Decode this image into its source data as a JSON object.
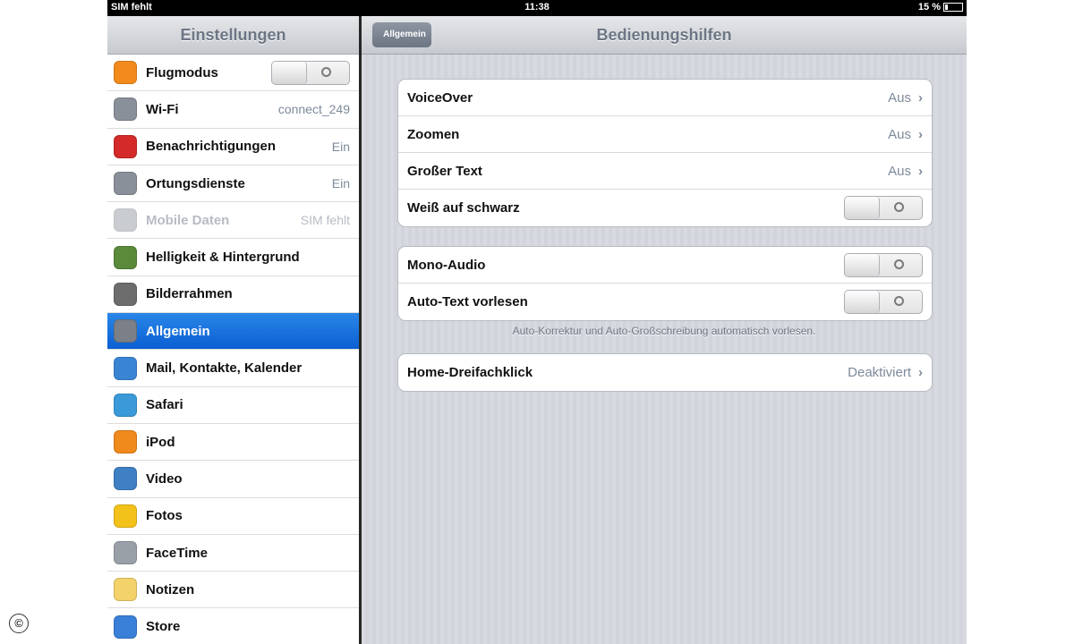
{
  "status": {
    "carrier": "SIM fehlt",
    "time": "11:38",
    "battery": "15 %"
  },
  "sidebar": {
    "title": "Einstellungen",
    "items": [
      {
        "label": "Flugmodus",
        "value": "",
        "icon": "airplane-icon",
        "color": "#f28b1c",
        "toggle": true,
        "disabled": false,
        "selected": false
      },
      {
        "label": "Wi-Fi",
        "value": "connect_249",
        "icon": "wifi-icon",
        "color": "#8a9099",
        "toggle": false,
        "disabled": false,
        "selected": false
      },
      {
        "label": "Benachrichtigungen",
        "value": "Ein",
        "icon": "notifications-icon",
        "color": "#d42a2a",
        "toggle": false,
        "disabled": false,
        "selected": false
      },
      {
        "label": "Ortungsdienste",
        "value": "Ein",
        "icon": "location-icon",
        "color": "#8a9099",
        "toggle": false,
        "disabled": false,
        "selected": false
      },
      {
        "label": "Mobile Daten",
        "value": "SIM fehlt",
        "icon": "cellular-icon",
        "color": "#8a9099",
        "toggle": false,
        "disabled": true,
        "selected": false
      },
      {
        "label": "Helligkeit & Hintergrund",
        "value": "",
        "icon": "brightness-icon",
        "color": "#5a8a3a",
        "toggle": false,
        "disabled": false,
        "selected": false
      },
      {
        "label": "Bilderrahmen",
        "value": "",
        "icon": "picture-frame-icon",
        "color": "#6d6d6d",
        "toggle": false,
        "disabled": false,
        "selected": false
      },
      {
        "label": "Allgemein",
        "value": "",
        "icon": "gear-icon",
        "color": "#7a7f88",
        "toggle": false,
        "disabled": false,
        "selected": true
      },
      {
        "label": "Mail, Kontakte, Kalender",
        "value": "",
        "icon": "mail-icon",
        "color": "#3a84d4",
        "toggle": false,
        "disabled": false,
        "selected": false
      },
      {
        "label": "Safari",
        "value": "",
        "icon": "safari-icon",
        "color": "#3a9ad9",
        "toggle": false,
        "disabled": false,
        "selected": false
      },
      {
        "label": "iPod",
        "value": "",
        "icon": "ipod-icon",
        "color": "#f08a1c",
        "toggle": false,
        "disabled": false,
        "selected": false
      },
      {
        "label": "Video",
        "value": "",
        "icon": "video-icon",
        "color": "#3f7fc4",
        "toggle": false,
        "disabled": false,
        "selected": false
      },
      {
        "label": "Fotos",
        "value": "",
        "icon": "photos-icon",
        "color": "#f3c21a",
        "toggle": false,
        "disabled": false,
        "selected": false
      },
      {
        "label": "FaceTime",
        "value": "",
        "icon": "facetime-icon",
        "color": "#9aa0a8",
        "toggle": false,
        "disabled": false,
        "selected": false
      },
      {
        "label": "Notizen",
        "value": "",
        "icon": "notes-icon",
        "color": "#f3d26a",
        "toggle": false,
        "disabled": false,
        "selected": false
      },
      {
        "label": "Store",
        "value": "",
        "icon": "store-icon",
        "color": "#3a7fd8",
        "toggle": false,
        "disabled": false,
        "selected": false
      }
    ]
  },
  "nav": {
    "back_label": "Allgemein",
    "title": "Bedienungshilfen"
  },
  "group1": {
    "rows": [
      {
        "label": "VoiceOver",
        "value": "Aus",
        "type": "disclosure"
      },
      {
        "label": "Zoomen",
        "value": "Aus",
        "type": "disclosure"
      },
      {
        "label": "Großer Text",
        "value": "Aus",
        "type": "disclosure"
      },
      {
        "label": "Weiß auf schwarz",
        "value": "",
        "type": "toggle"
      }
    ]
  },
  "group2": {
    "rows": [
      {
        "label": "Mono-Audio",
        "value": "",
        "type": "toggle"
      },
      {
        "label": "Auto-Text vorlesen",
        "value": "",
        "type": "toggle"
      }
    ],
    "footnote": "Auto-Korrektur und Auto-Großschreibung automatisch vorlesen."
  },
  "group3": {
    "rows": [
      {
        "label": "Home-Dreifachklick",
        "value": "Deaktiviert",
        "type": "disclosure"
      }
    ]
  },
  "chevron": "›",
  "watermark": "©"
}
